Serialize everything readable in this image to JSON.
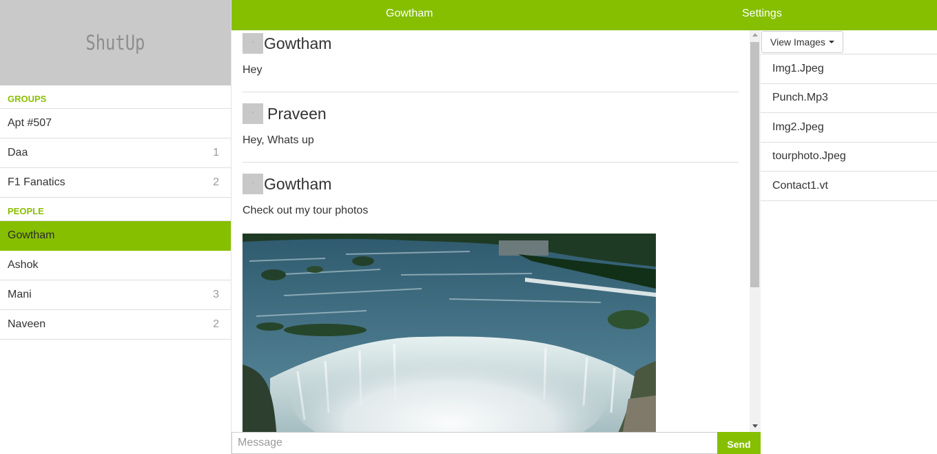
{
  "brand": {
    "name": "ShutUp"
  },
  "sidebar": {
    "groups_label": "GROUPS",
    "groups": [
      {
        "name": "Apt #507",
        "count": ""
      },
      {
        "name": "Daa",
        "count": "1"
      },
      {
        "name": "F1 Fanatics",
        "count": "2"
      }
    ],
    "people_label": "PEOPLE",
    "people": [
      {
        "name": "Gowtham",
        "count": "",
        "active": true
      },
      {
        "name": "Ashok",
        "count": ""
      },
      {
        "name": "Mani",
        "count": "3"
      },
      {
        "name": "Naveen",
        "count": "2"
      }
    ]
  },
  "header": {
    "contact": "Gowtham",
    "settings": "Settings"
  },
  "messages": [
    {
      "sender": "Gowtham",
      "text": "Hey"
    },
    {
      "sender": "Praveen",
      "text": "Hey, Whats up"
    },
    {
      "sender": "Gowtham",
      "text": "Check out my tour photos",
      "image": "waterfall photo"
    }
  ],
  "composer": {
    "placeholder": "Message",
    "send_label": "Send"
  },
  "files_panel": {
    "dropdown_label": "View Images",
    "files": [
      "Img1.Jpeg",
      "Punch.Mp3",
      "Img2.Jpeg",
      "tourphoto.Jpeg",
      "Contact1.vt"
    ]
  },
  "colors": {
    "accent": "#86bf00",
    "brand_bg": "#c9c9c9",
    "brand_text": "#8d8d8d"
  }
}
